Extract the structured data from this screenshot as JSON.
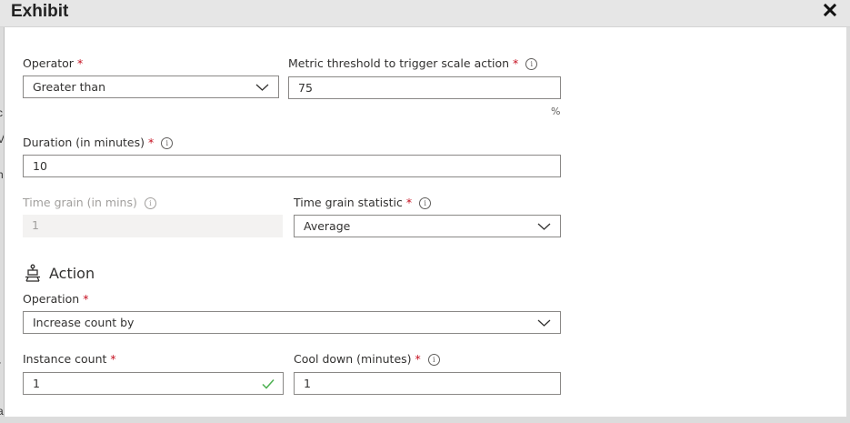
{
  "window": {
    "title": "Exhibit"
  },
  "background_fragments": [
    "c",
    "V",
    "h",
    "r",
    "a"
  ],
  "form": {
    "operator": {
      "label": "Operator",
      "required": "*",
      "value": "Greater than"
    },
    "metric_threshold": {
      "label": "Metric threshold to trigger scale action",
      "required": "*",
      "info": "i",
      "value": "75",
      "unit": "%"
    },
    "duration": {
      "label": "Duration (in minutes)",
      "required": "*",
      "info": "i",
      "value": "10"
    },
    "time_grain": {
      "label": "Time grain (in mins)",
      "info": "i",
      "value": "1"
    },
    "time_grain_statistic": {
      "label": "Time grain statistic",
      "required": "*",
      "info": "i",
      "value": "Average"
    },
    "action_section": {
      "title": "Action"
    },
    "operation": {
      "label": "Operation",
      "required": "*",
      "value": "Increase count by"
    },
    "instance_count": {
      "label": "Instance count",
      "required": "*",
      "value": "1"
    },
    "cool_down": {
      "label": "Cool down (minutes)",
      "required": "*",
      "info": "i",
      "value": "1"
    }
  },
  "icons": {
    "close": "close-icon",
    "info": "info-icon",
    "chevron": "chevron-down-icon",
    "check": "checkmark-icon",
    "action": "scale-action-icon"
  },
  "colors": {
    "required": "#c50f1f",
    "check": "#4cb050",
    "titlebar": "#e6e6e6",
    "border": "#8a8886"
  }
}
